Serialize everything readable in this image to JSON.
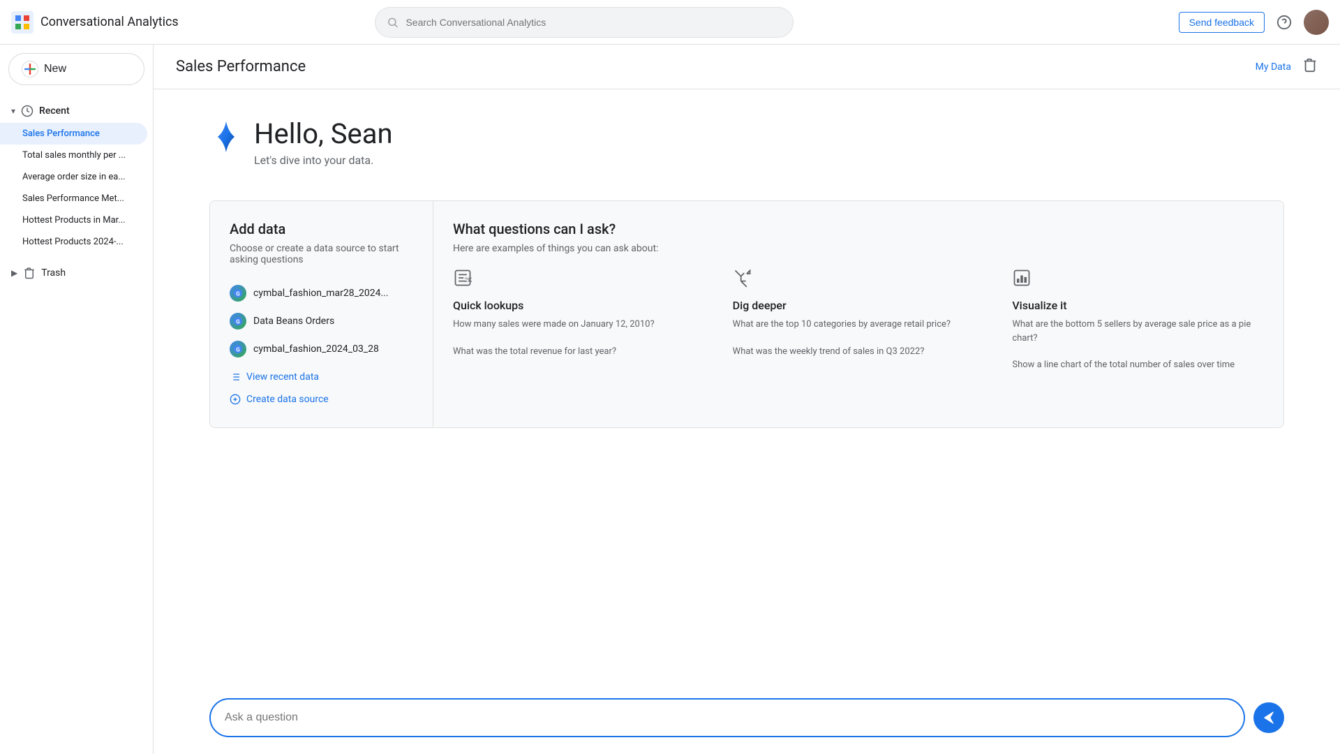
{
  "topbar": {
    "logo_text": "Conversational Analytics",
    "search_placeholder": "Search Conversational Analytics",
    "send_feedback": "Send feedback"
  },
  "sidebar": {
    "new_button": "New",
    "recent_label": "Recent",
    "items": [
      {
        "label": "Sales Performance",
        "active": true
      },
      {
        "label": "Total sales monthly per ..."
      },
      {
        "label": "Average order size in ea..."
      },
      {
        "label": "Sales Performance Met..."
      },
      {
        "label": "Hottest Products in Mar..."
      },
      {
        "label": "Hottest Products 2024-..."
      }
    ],
    "trash_label": "Trash"
  },
  "page": {
    "title": "Sales Performance",
    "my_data": "My Data"
  },
  "hero": {
    "greeting": "Hello, Sean",
    "subtitle": "Let's dive into your data."
  },
  "add_data": {
    "title": "Add data",
    "subtitle": "Choose or create a data source to start asking questions",
    "sources": [
      {
        "name": "cymbal_fashion_mar28_2024..."
      },
      {
        "name": "Data Beans Orders"
      },
      {
        "name": "cymbal_fashion_2024_03_28"
      }
    ],
    "view_recent": "View recent data",
    "create_source": "Create data source"
  },
  "questions": {
    "title": "What questions can I ask?",
    "subtitle": "Here are examples of things you can ask about:",
    "columns": [
      {
        "icon": "quick-lookup-icon",
        "title": "Quick lookups",
        "examples": [
          "How many sales were made on January 12, 2010?",
          "What was the total revenue for last year?"
        ]
      },
      {
        "icon": "dig-deeper-icon",
        "title": "Dig deeper",
        "examples": [
          "What are the top 10 categories by average retail price?",
          "What was the weekly trend of sales in Q3 2022?"
        ]
      },
      {
        "icon": "visualize-icon",
        "title": "Visualize it",
        "examples": [
          "What are the bottom 5 sellers by average sale price as a pie chart?",
          "Show a line chart of the total number of sales over time"
        ]
      }
    ]
  },
  "bottom_input": {
    "placeholder": "Ask a question"
  }
}
